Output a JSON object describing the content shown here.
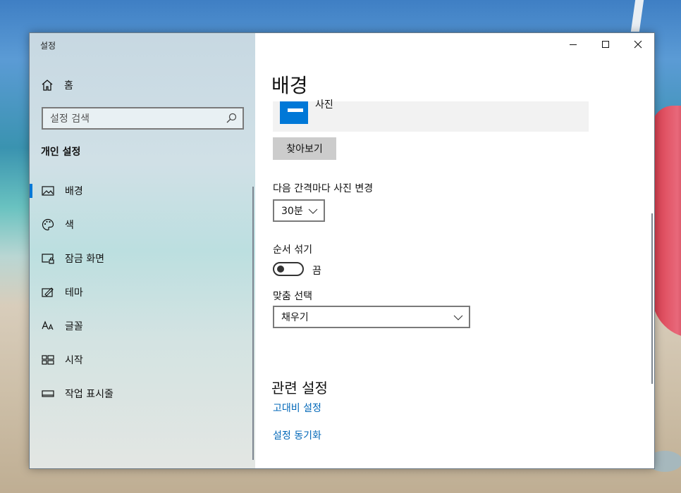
{
  "app": {
    "title": "설정"
  },
  "sidebar": {
    "home_label": "홈",
    "search_placeholder": "설정 검색",
    "section_heading": "개인 설정",
    "items": [
      {
        "label": "배경",
        "icon": "picture-icon",
        "active": true
      },
      {
        "label": "색",
        "icon": "palette-icon",
        "active": false
      },
      {
        "label": "잠금 화면",
        "icon": "lock-screen-icon",
        "active": false
      },
      {
        "label": "테마",
        "icon": "theme-icon",
        "active": false
      },
      {
        "label": "글꼴",
        "icon": "font-icon",
        "active": false
      },
      {
        "label": "시작",
        "icon": "start-icon",
        "active": false
      },
      {
        "label": "작업 표시줄",
        "icon": "taskbar-icon",
        "active": false
      }
    ]
  },
  "window_controls": {
    "minimize": "minimize-icon",
    "maximize": "maximize-icon",
    "close": "close-icon"
  },
  "main": {
    "title": "배경",
    "background_choice": "사진",
    "browse_label": "찾아보기",
    "interval_label": "다음 간격마다 사진 변경",
    "interval_value": "30분",
    "shuffle_label": "순서 섞기",
    "shuffle_state": "끔",
    "shuffle_on": false,
    "fit_label": "맞춤 선택",
    "fit_value": "채우기",
    "related_heading": "관련 설정",
    "related_links": [
      "고대비 설정",
      "설정 동기화"
    ]
  },
  "colors": {
    "accent": "#0078d7",
    "link": "#0067b8"
  }
}
